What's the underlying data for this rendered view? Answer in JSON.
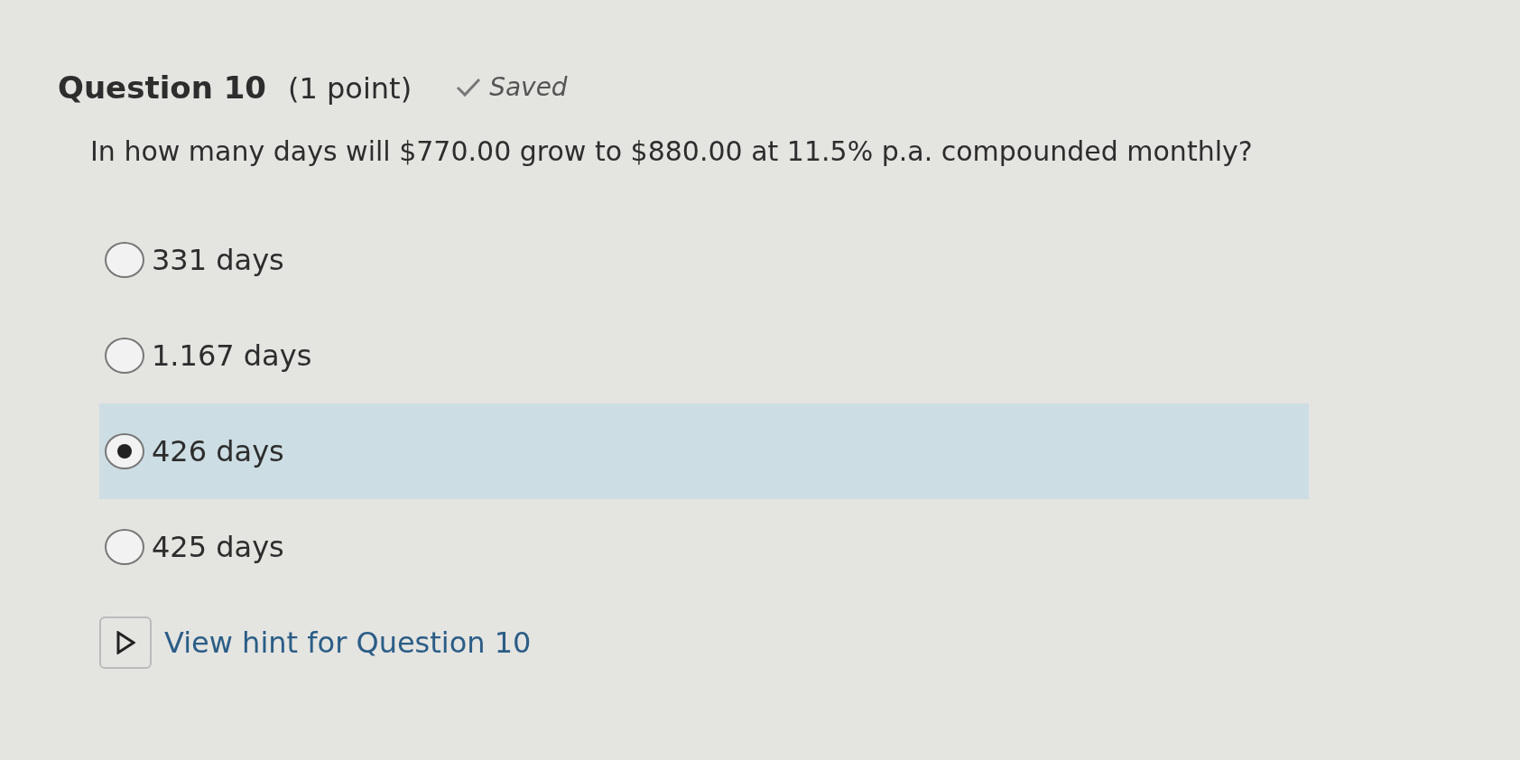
{
  "question": {
    "title": "Question 10",
    "points": "(1 point)",
    "status": "Saved",
    "text": "In how many days will $770.00 grow to $880.00 at 11.5% p.a. compounded monthly?"
  },
  "options": [
    {
      "label": "331 days",
      "selected": false
    },
    {
      "label": "1.167 days",
      "selected": false
    },
    {
      "label": "426 days",
      "selected": true
    },
    {
      "label": "425 days",
      "selected": false
    }
  ],
  "hint": {
    "label": "View hint for Question 10"
  }
}
